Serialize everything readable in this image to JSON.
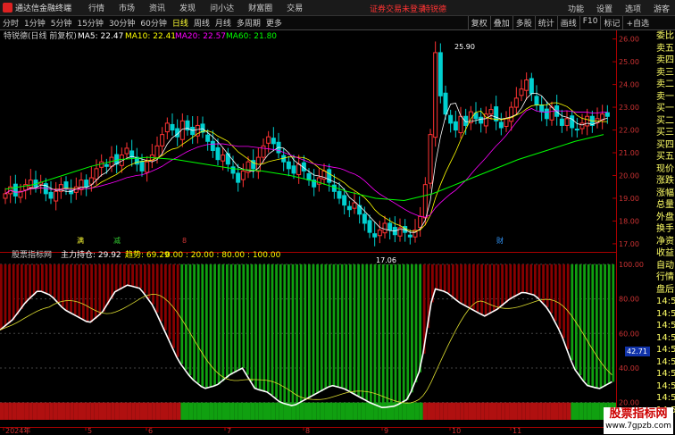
{
  "app": {
    "name": "通达信金融终端",
    "menus": [
      "行情",
      "市场",
      "资讯",
      "发现",
      "问小达",
      "财富圈",
      "交易"
    ],
    "warn": "证券交易未登录",
    "warn_stock": "特锐德",
    "topright": [
      "功能",
      "设置",
      "选项"
    ],
    "guest": "游客"
  },
  "tabs": [
    "分时",
    "1分钟",
    "5分钟",
    "15分钟",
    "30分钟",
    "60分钟",
    "日线",
    "周线",
    "月线",
    "多周期",
    "更多"
  ],
  "active_tab": "日线",
  "rtabs": [
    "复权",
    "叠加",
    "多股",
    "统计",
    "画线",
    "F10",
    "标记",
    "+自选"
  ],
  "main_title": {
    "stock": "特锐德(日线 前复权)",
    "ma": [
      {
        "label": "MA5: 22.47",
        "color": "#ffffff"
      },
      {
        "label": "MA10: 22.41",
        "color": "#ffff00"
      },
      {
        "label": "MA20: 22.57",
        "color": "#ff00ff"
      },
      {
        "label": "MA60: 21.80",
        "color": "#00ff00"
      }
    ]
  },
  "sub_title": {
    "name": "股票指标网",
    "label": "主力持仓: 29.92",
    "trend": "趋势: 69.29",
    "levels": "0.00 : 20.00 : 80.00 : 100.00"
  },
  "side_labels": [
    "委比",
    "卖五",
    "卖四",
    "卖三",
    "卖二",
    "卖一",
    "买一",
    "买二",
    "买三",
    "买四",
    "买五",
    "现价",
    "涨跌",
    "涨幅",
    "总量",
    "外盘",
    "换手",
    "净资",
    "收益",
    "自动",
    "行情",
    "盘后",
    "14:5",
    "14:5",
    "14:5",
    "14:5",
    "14:5",
    "14:5",
    "14:5",
    "14:5",
    "14:5",
    "14:5"
  ],
  "watermark": {
    "text": "股票指标网",
    "url": "www.7gpzb.com"
  },
  "chart_data": {
    "type": "candlestick",
    "price_axis": {
      "ticks": [
        17.0,
        18.0,
        19.0,
        20.0,
        21.0,
        22.0,
        23.0,
        24.0,
        25.0,
        26.0
      ],
      "ylim": [
        16.8,
        26.3
      ]
    },
    "indicator_axis": {
      "ticks": [
        20.0,
        40.0,
        60.0,
        80.0,
        100.0
      ],
      "ylim": [
        10,
        102
      ],
      "current": "42.71"
    },
    "x_labels": [
      "2024年",
      "5",
      "6",
      "7",
      "8",
      "9",
      "10",
      "11"
    ],
    "annotations": {
      "high": "25.90",
      "low": "17.06",
      "tag_a": "满",
      "tag_b": "减",
      "tag_c": "8",
      "tag_d": "财"
    },
    "closes": [
      19.2,
      19.5,
      19.1,
      19.3,
      19.6,
      19.8,
      19.5,
      19.7,
      19.2,
      19.0,
      19.3,
      19.6,
      19.4,
      19.2,
      19.5,
      19.8,
      19.5,
      19.9,
      20.3,
      20.6,
      20.4,
      20.8,
      20.5,
      20.9,
      21.2,
      20.8,
      20.5,
      20.2,
      20.6,
      20.9,
      21.3,
      21.8,
      22.3,
      22.0,
      21.7,
      22.4,
      22.0,
      21.8,
      22.2,
      21.9,
      21.5,
      21.1,
      20.7,
      20.9,
      20.5,
      20.1,
      19.7,
      20.2,
      20.6,
      20.3,
      20.8,
      21.3,
      21.7,
      21.4,
      21.0,
      20.6,
      20.3,
      20.1,
      20.5,
      20.2,
      19.8,
      19.5,
      19.9,
      20.2,
      19.7,
      19.3,
      19.0,
      18.7,
      18.5,
      18.8,
      18.3,
      17.9,
      17.5,
      17.3,
      17.6,
      17.9,
      17.6,
      17.4,
      17.7,
      17.5,
      17.3,
      17.6,
      18.2,
      19.6,
      21.8,
      25.4,
      23.5,
      22.7,
      22.3,
      22.0,
      22.6,
      22.2,
      22.8,
      22.5,
      22.3,
      22.7,
      22.9,
      22.4,
      22.1,
      22.5,
      23.0,
      23.4,
      23.8,
      24.2,
      23.6,
      23.1,
      22.8,
      22.5,
      23.0,
      22.6,
      22.2,
      22.5,
      22.1,
      22.0,
      22.3,
      22.6,
      22.2,
      22.5,
      22.7,
      22.6
    ],
    "ma60_points": [
      19.4,
      19.6,
      20.0,
      20.4,
      20.7,
      20.8,
      20.7,
      20.5,
      20.3,
      20.2,
      20.0,
      19.7,
      19.3,
      19.0,
      18.9,
      19.2,
      19.7,
      20.2,
      20.7,
      21.1,
      21.5,
      21.8
    ],
    "indicator_points": [
      62,
      68,
      78,
      85,
      82,
      74,
      70,
      66,
      72,
      84,
      88,
      86,
      76,
      60,
      44,
      34,
      28,
      30,
      36,
      40,
      28,
      26,
      20,
      18,
      22,
      26,
      30,
      28,
      24,
      20,
      17,
      18,
      22,
      40,
      86,
      84,
      78,
      74,
      70,
      74,
      80,
      84,
      82,
      74,
      60,
      40,
      30,
      28,
      32
    ]
  }
}
